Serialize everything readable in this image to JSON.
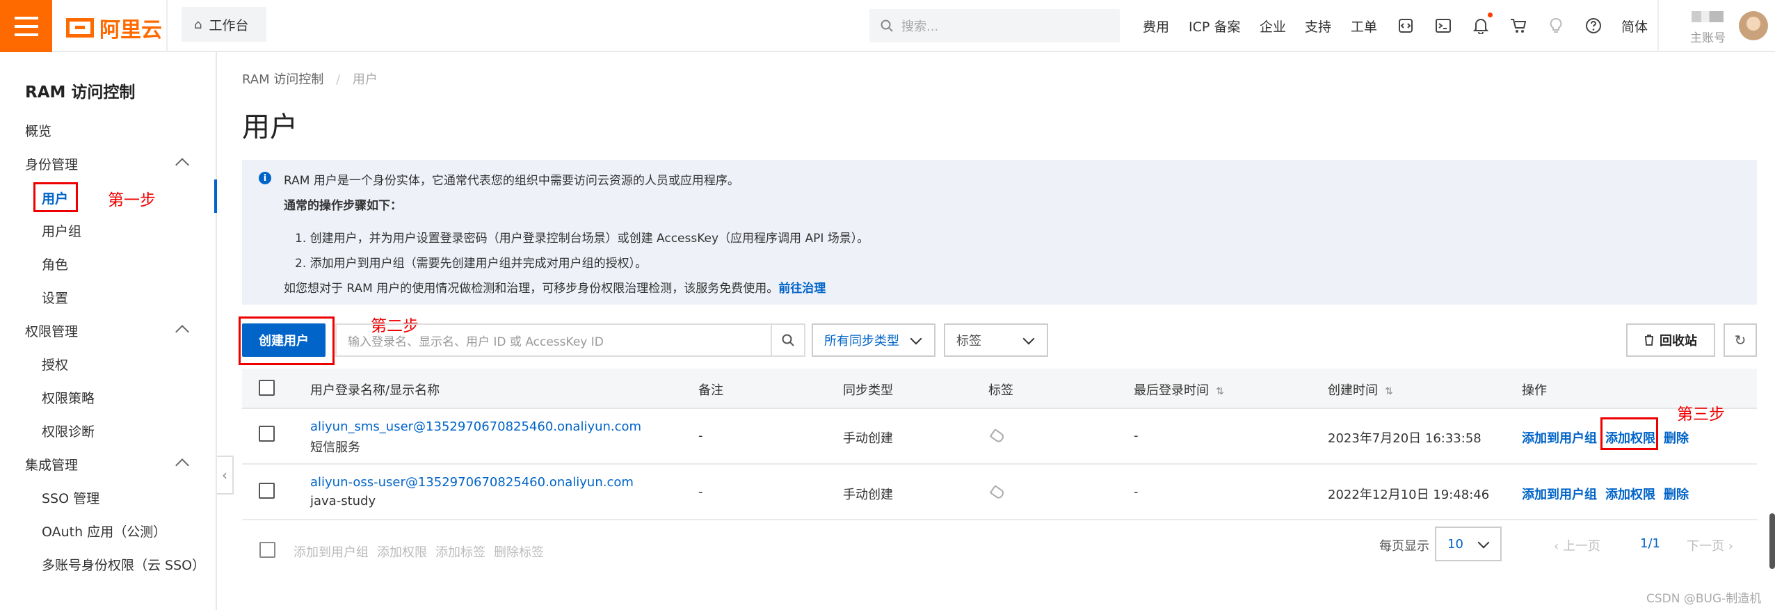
{
  "topbar": {
    "logo": "阿里云",
    "workbench": "工作台",
    "search_placeholder": "搜索...",
    "nav": [
      "费用",
      "ICP 备案",
      "企业",
      "支持",
      "工单"
    ],
    "lang": "简体",
    "account_label": "主账号"
  },
  "sidebar": {
    "title": "RAM 访问控制",
    "overview": "概览",
    "groups": [
      {
        "label": "身份管理",
        "items": [
          "用户",
          "用户组",
          "角色",
          "设置"
        ]
      },
      {
        "label": "权限管理",
        "items": [
          "授权",
          "权限策略",
          "权限诊断"
        ]
      },
      {
        "label": "集成管理",
        "items": [
          "SSO 管理",
          "OAuth 应用（公测）",
          "多账号身份权限（云 SSO）"
        ]
      }
    ],
    "active_item": "用户"
  },
  "annotations": {
    "step1": "第一步",
    "step2": "第二步",
    "step3": "第三步"
  },
  "breadcrumb": {
    "root": "RAM 访问控制",
    "sep": "/",
    "current": "用户"
  },
  "page_title": "用户",
  "notice": {
    "line1": "RAM 用户是一个身份实体，它通常代表您的组织中需要访问云资源的人员或应用程序。",
    "line2": "通常的操作步骤如下：",
    "line3": "1. 创建用户，并为用户设置登录密码（用户登录控制台场景）或创建 AccessKey（应用程序调用 API 场景）。",
    "line4": "2. 添加用户到用户组（需要先创建用户组并完成对用户组的授权）。",
    "line5_text": "如您想对于 RAM 用户的使用情况做检测和治理，可移步身份权限治理检测，该服务免费使用。",
    "line5_link": "前往治理"
  },
  "toolbar": {
    "create_button": "创建用户",
    "search_placeholder": "输入登录名、显示名、用户 ID 或 AccessKey ID",
    "sync_type_select": "所有同步类型",
    "tag_select": "标签",
    "recycle_button": "回收站"
  },
  "table": {
    "columns": [
      "用户登录名称/显示名称",
      "备注",
      "同步类型",
      "标签",
      "最后登录时间",
      "创建时间",
      "操作"
    ],
    "rows": [
      {
        "login": "aliyun_sms_user@1352970670825460.onaliyun.com",
        "display": "短信服务",
        "note": "-",
        "sync": "手动创建",
        "last_login": "-",
        "created": "2023年7月20日 16:33:58"
      },
      {
        "login": "aliyun-oss-user@1352970670825460.onaliyun.com",
        "display": "java-study",
        "note": "-",
        "sync": "手动创建",
        "last_login": "-",
        "created": "2022年12月10日 19:48:46"
      }
    ],
    "actions": [
      "添加到用户组",
      "添加权限",
      "删除"
    ]
  },
  "footer": {
    "bulk": [
      "添加到用户组",
      "添加权限",
      "添加标签",
      "删除标签"
    ],
    "per_page_label": "每页显示",
    "per_page": "10",
    "prev": "上一页",
    "page": "1/1",
    "next": "下一页"
  },
  "watermark": "CSDN @BUG-制造机",
  "colors": {
    "brand": "#ff6a00",
    "primary": "#0064c8",
    "annotation": "#e00000"
  }
}
